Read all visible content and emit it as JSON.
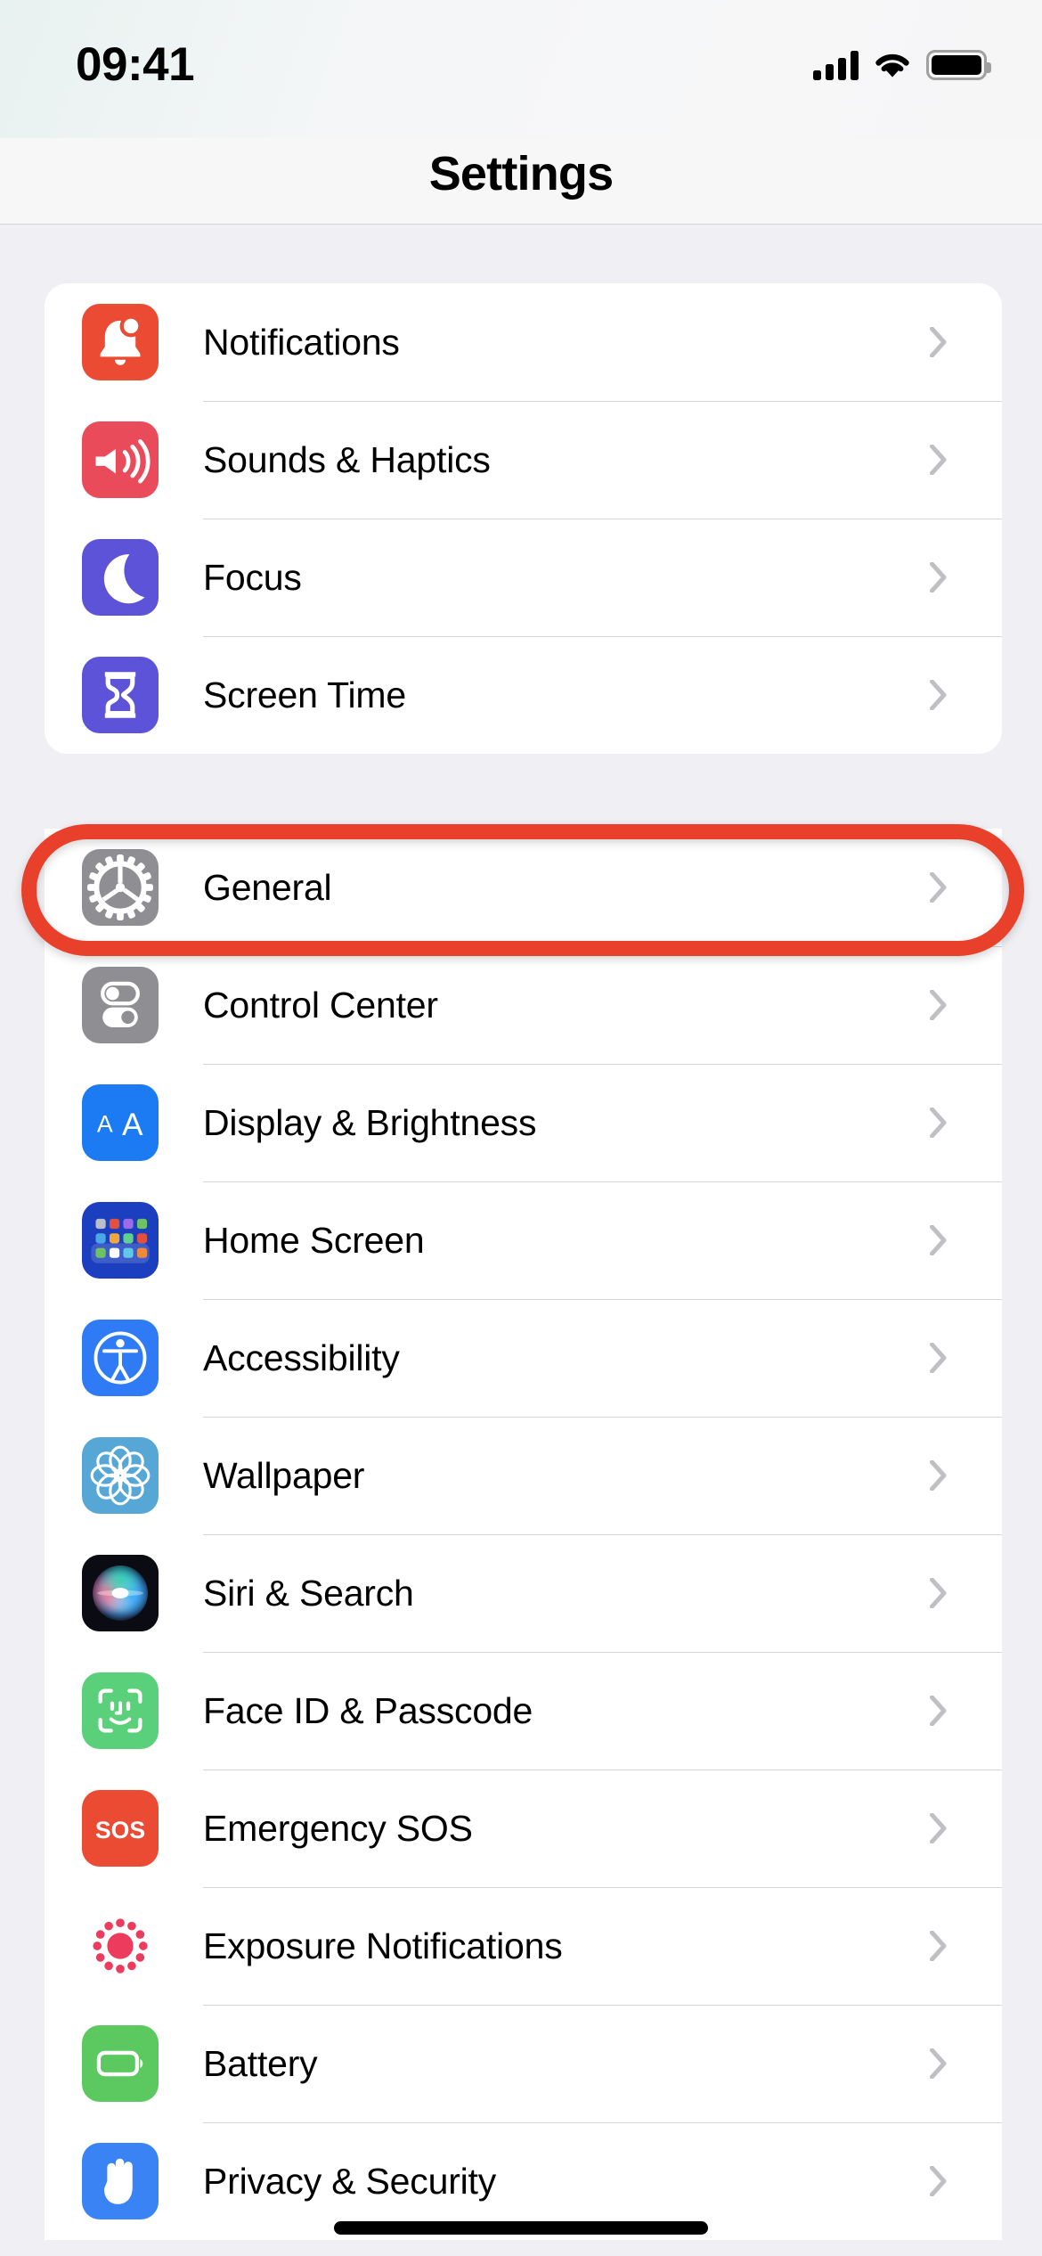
{
  "status_bar": {
    "time": "09:41",
    "cellular_icon": "cellular-signal-icon",
    "wifi_icon": "wifi-icon",
    "battery_icon": "battery-full-icon"
  },
  "nav": {
    "title": "Settings"
  },
  "annotation": {
    "type": "highlight-oval",
    "target": "General",
    "color": "#E8402A"
  },
  "groups": [
    {
      "id": "group-1",
      "rows": [
        {
          "label": "Notifications",
          "icon": "bell-badge-icon",
          "icon_color": "#EB4B33",
          "chevron": "chevron-right-icon"
        },
        {
          "label": "Sounds & Haptics",
          "icon": "speaker-waves-icon",
          "icon_color": "#E94B5B",
          "chevron": "chevron-right-icon"
        },
        {
          "label": "Focus",
          "icon": "moon-icon",
          "icon_color": "#5C53D8",
          "chevron": "chevron-right-icon"
        },
        {
          "label": "Screen Time",
          "icon": "hourglass-icon",
          "icon_color": "#5C53D8",
          "chevron": "chevron-right-icon"
        }
      ]
    },
    {
      "id": "group-2",
      "rows": [
        {
          "label": "General",
          "icon": "gear-icon",
          "icon_color": "#8E8E93",
          "chevron": "chevron-right-icon"
        },
        {
          "label": "Control Center",
          "icon": "toggles-icon",
          "icon_color": "#8E8E93",
          "chevron": "chevron-right-icon"
        },
        {
          "label": "Display & Brightness",
          "icon": "aa-text-size-icon",
          "icon_color": "#1C7BF3",
          "chevron": "chevron-right-icon"
        },
        {
          "label": "Home Screen",
          "icon": "app-grid-icon",
          "icon_color": "#1B3FBE",
          "chevron": "chevron-right-icon"
        },
        {
          "label": "Accessibility",
          "icon": "accessibility-icon",
          "icon_color": "#2F7BF6",
          "chevron": "chevron-right-icon"
        },
        {
          "label": "Wallpaper",
          "icon": "flower-icon",
          "icon_color": "#56A7D6",
          "chevron": "chevron-right-icon"
        },
        {
          "label": "Siri & Search",
          "icon": "siri-orb-icon",
          "icon_color": "#1A1A1E",
          "chevron": "chevron-right-icon"
        },
        {
          "label": "Face ID & Passcode",
          "icon": "face-id-icon",
          "icon_color": "#5BD07A",
          "chevron": "chevron-right-icon"
        },
        {
          "label": "Emergency SOS",
          "icon": "sos-icon",
          "icon_color": "#EB4B33",
          "chevron": "chevron-right-icon"
        },
        {
          "label": "Exposure Notifications",
          "icon": "exposure-dots-icon",
          "icon_color": "#FFFFFF",
          "chevron": "chevron-right-icon"
        },
        {
          "label": "Battery",
          "icon": "battery-icon",
          "icon_color": "#5BC95F",
          "chevron": "chevron-right-icon"
        },
        {
          "label": "Privacy & Security",
          "icon": "raised-hand-icon",
          "icon_color": "#3A83F5",
          "chevron": "chevron-right-icon"
        }
      ]
    }
  ],
  "home_indicator": "home-indicator-bar"
}
